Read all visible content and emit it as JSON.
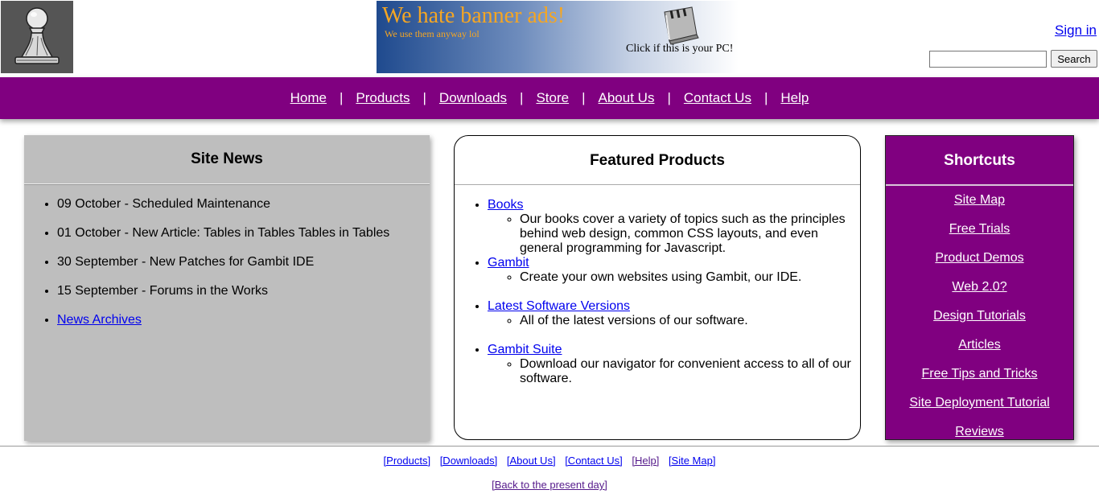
{
  "header": {
    "logo_icon": "chess-pawn-icon",
    "banner": {
      "title": "We hate banner ads!",
      "subtitle": "We use them anyway lol",
      "cta": "Click if this is your PC!",
      "image_icon": "toaster-icon",
      "title_color": "#f5a623"
    },
    "sign_in": "Sign in",
    "search": {
      "value": "",
      "placeholder": "",
      "button": "Search"
    }
  },
  "nav": {
    "separator": "|",
    "items": [
      "Home",
      "Products",
      "Downloads",
      "Store",
      "About Us",
      "Contact Us",
      "Help"
    ]
  },
  "news": {
    "title": "Site News",
    "items": [
      "09 October - Scheduled Maintenance",
      "01 October - New Article: Tables in Tables Tables in Tables",
      "30 September - New Patches for Gambit IDE",
      "15 September - Forums in the Works"
    ],
    "archive_link": "News Archives"
  },
  "featured": {
    "title": "Featured Products",
    "products": [
      {
        "name": "Books",
        "description": "Our books cover a variety of topics such as the principles behind web design, common CSS layouts, and even general programming for Javascript."
      },
      {
        "name": "Gambit",
        "description": "Create your own websites using Gambit, our IDE."
      },
      {
        "name": "Latest Software Versions",
        "description": "All of the latest versions of our software."
      },
      {
        "name": "Gambit Suite",
        "description": "Download our navigator for convenient access to all of our software."
      }
    ]
  },
  "shortcuts": {
    "title": "Shortcuts",
    "items": [
      "Site Map",
      "Free Trials",
      "Product Demos",
      "Web 2.0?",
      "Design Tutorials",
      "Articles",
      "Free Tips and Tricks",
      "Site Deployment Tutorial",
      "Reviews"
    ]
  },
  "footer": {
    "links": [
      "[Products]",
      "[Downloads]",
      "[About Us]",
      "[Contact Us]",
      "[Help]",
      "[Site Map]"
    ],
    "back_link": "[Back to the present day]"
  },
  "colors": {
    "nav_background": "#800080",
    "news_background": "#bebebe",
    "link": "#0000ee",
    "visited_link": "#551a8b"
  }
}
